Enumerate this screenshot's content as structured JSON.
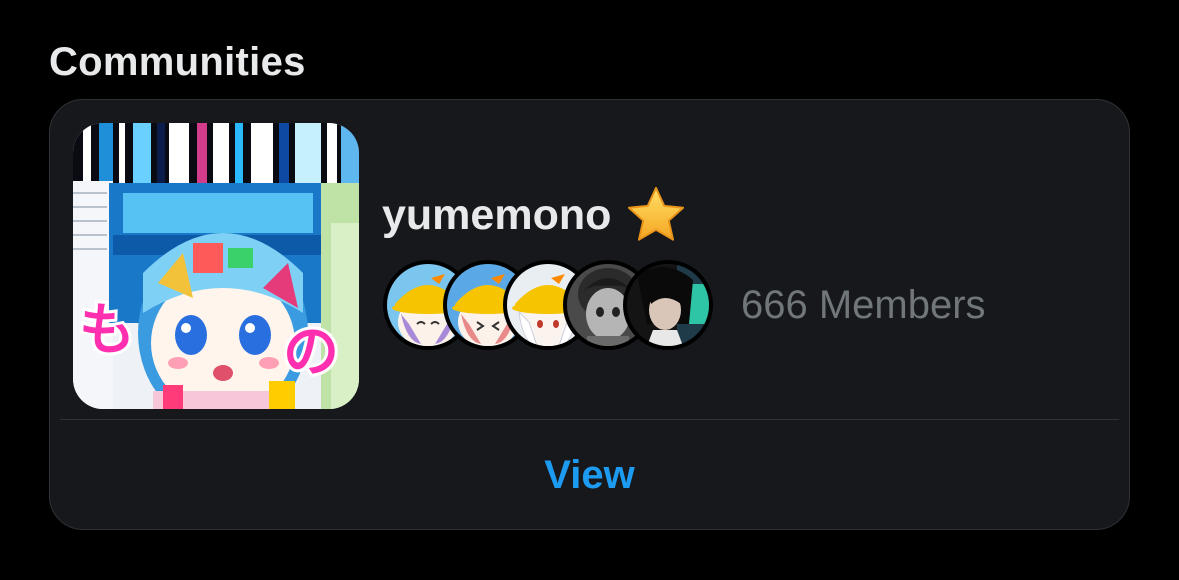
{
  "section": {
    "title": "Communities"
  },
  "community": {
    "name": "yumemono",
    "badge_icon": "star-emoji-icon",
    "members_label": "666 Members",
    "thumbnail_text": [
      "も",
      "の"
    ],
    "avatar_count": 5,
    "view_label": "View"
  },
  "colors": {
    "background": "#000000",
    "card": "#16181c",
    "border": "#2f3336",
    "primary_text": "#e7e9ea",
    "secondary_text": "#71767b",
    "accent": "#1d9bf0"
  }
}
